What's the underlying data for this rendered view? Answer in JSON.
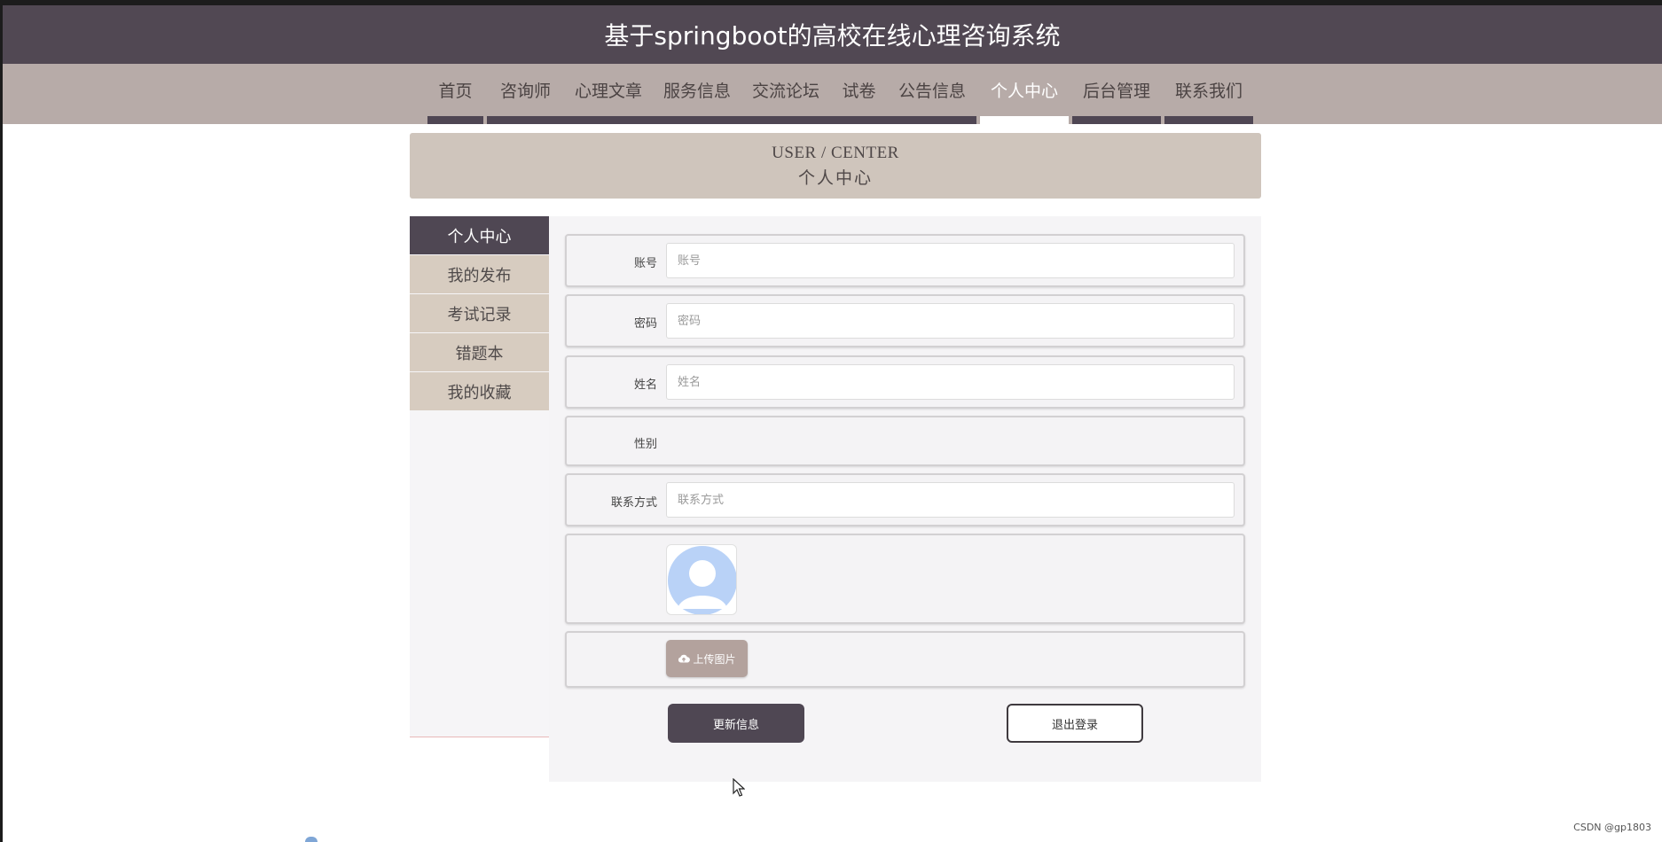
{
  "header": {
    "title": "基于springboot的高校在线心理咨询系统"
  },
  "nav": {
    "items": [
      {
        "label": "首页",
        "active": false
      },
      {
        "label": "咨询师",
        "active": false
      },
      {
        "label": "心理文章",
        "active": false
      },
      {
        "label": "服务信息",
        "active": false
      },
      {
        "label": "交流论坛",
        "active": false
      },
      {
        "label": "试卷",
        "active": false
      },
      {
        "label": "公告信息",
        "active": false
      },
      {
        "label": "个人中心",
        "active": true
      },
      {
        "label": "后台管理",
        "active": false
      },
      {
        "label": "联系我们",
        "active": false
      }
    ]
  },
  "banner": {
    "en": "USER / CENTER",
    "cn": "个人中心"
  },
  "sidebar": {
    "items": [
      {
        "label": "个人中心",
        "active": true
      },
      {
        "label": "我的发布",
        "active": false
      },
      {
        "label": "考试记录",
        "active": false
      },
      {
        "label": "错题本",
        "active": false
      },
      {
        "label": "我的收藏",
        "active": false
      }
    ]
  },
  "form": {
    "account": {
      "label": "账号",
      "placeholder": "账号",
      "value": ""
    },
    "password": {
      "label": "密码",
      "placeholder": "密码",
      "value": ""
    },
    "name": {
      "label": "姓名",
      "placeholder": "姓名",
      "value": ""
    },
    "gender": {
      "label": "性别"
    },
    "contact": {
      "label": "联系方式",
      "placeholder": "联系方式",
      "value": ""
    },
    "upload_label": "上传图片",
    "update_label": "更新信息",
    "logout_label": "退出登录"
  },
  "watermark": "CSDN @gp1803",
  "colors": {
    "header_bg": "#514853",
    "nav_bg": "#b7aba8",
    "banner_bg": "#cfc5bc",
    "sidebar_active_bg": "#4f4753",
    "sidebar_item_bg": "#d7ccc0",
    "upload_btn_bg": "#b3a29d"
  }
}
